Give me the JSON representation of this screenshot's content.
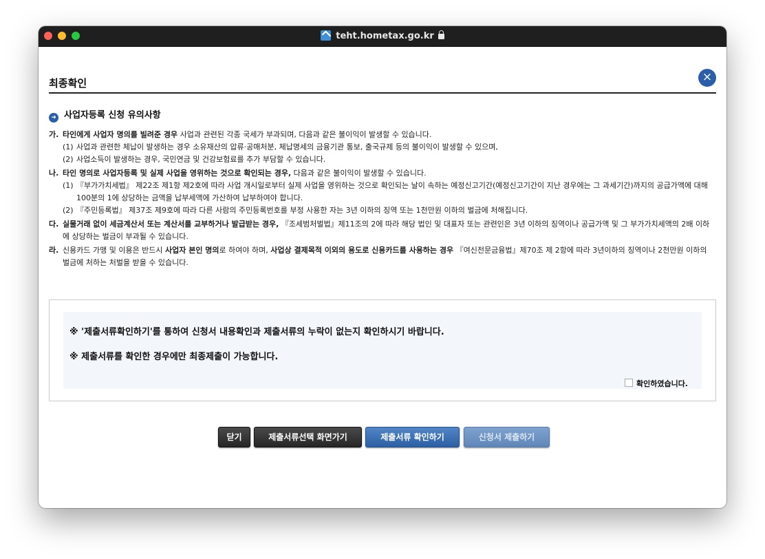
{
  "browser": {
    "url": "teht.hometax.go.kr"
  },
  "dialog": {
    "title": "최종확인",
    "close_symbol": "×",
    "section_title": "사업자등록 신청 유의사항"
  },
  "notice": {
    "ga": {
      "lead": "가.",
      "bold": "타인에게 사업자 명의를 빌려준 경우",
      "text": " 사업과 관련된 각종 국세가 부과되며, 다음과 같은 불이익이 발생할 수 있습니다.",
      "subs": [
        {
          "num": "(1)",
          "text": "사업과 관련한 체납이 발생하는 경우 소유재산의 압류·공매처분, 체납명세의 금융기관 통보, 출국규제 등의 불이익이 발생할 수 있으며,"
        },
        {
          "num": "(2)",
          "text": "사업소득이 발생하는 경우, 국민연금 및 건강보험료를 추가 부담할 수 있습니다."
        }
      ]
    },
    "na": {
      "lead": "나.",
      "bold": "타인 명의로 사업자등록 및 실제 사업을 영위하는 것으로 확인되는 경우,",
      "text": " 다음과 같은 불이익이 발생할 수 있습니다.",
      "subs": [
        {
          "num": "(1)",
          "text": "『부가가치세법』 제22조 제1항 제2호에 따라 사업 개시일로부터 실제 사업을 영위하는 것으로 확인되는 날이 속하는 예정신고기간(예정신고기간이 지난 경우에는 그 과세기간)까지의 공급가액에 대해 100분의 1에 상당하는 금액을 납부세액에 가산하여 납부하여야 합니다."
        },
        {
          "num": "(2)",
          "text": "『주민등록법』 제37조 제9호에 따라 다른 사람의 주민등록번호를 부정 사용한 자는 3년 이하의 징역 또는 1천만원 이하의 벌금에 처해집니다."
        }
      ]
    },
    "da": {
      "lead": "다.",
      "bold": "실물거래 없이 세금계산서 또는 계산서를 교부하거나 발급받는 경우,",
      "text": " 『조세범처벌법』제11조의 2에 따라 해당 법인 및 대표자 또는 관련인은 3년 이하의 징역이나 공급가액 및 그 부가가치세액의 2배 이하에 상당하는 벌금이 부과될 수 있습니다."
    },
    "ra": {
      "lead": "라.",
      "text1": "신용카드 가맹 및 이용은 반드시 ",
      "bold1": "사업자 본인 명의",
      "text2": "로 하여야 하며, ",
      "bold2": "사업상 결제목적 이외의 용도로 신용카드를 사용하는 경우",
      "text3": " 『여신전문금융법』제70조 제 2항에 따라 3년이하의 징역이나 2천만원 이하의 벌금에 처하는 처벌을 받을 수 있습니다."
    }
  },
  "confirm": {
    "line1": "※  '제출서류확인하기'를 통하여 신청서 내용확인과 제출서류의 누락이 없는지 확인하시기 바랍니다.",
    "line2": "※  제출서류를 확인한 경우에만 최종제출이 가능합니다.",
    "checkbox_label": "확인하였습니다."
  },
  "buttons": {
    "close": "닫기",
    "goto_select": "제출서류선택 화면가기",
    "check_docs": "제출서류 확인하기",
    "submit": "신청서 제출하기"
  },
  "colors": {
    "accent_blue": "#2a5ea8",
    "button_dark": "#2f2f2f",
    "panel_bg": "#f3f6fb"
  }
}
